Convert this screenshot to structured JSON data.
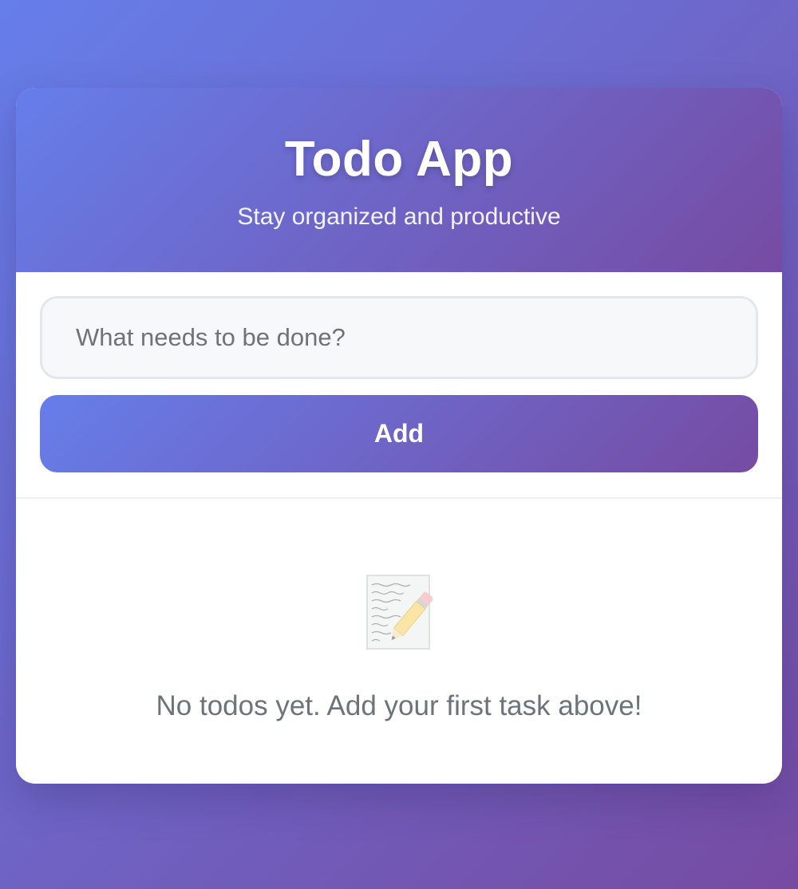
{
  "header": {
    "title": "Todo App",
    "subtitle": "Stay organized and productive"
  },
  "form": {
    "input_placeholder": "What needs to be done?",
    "input_value": "",
    "add_label": "Add"
  },
  "empty_state": {
    "icon": "memo-icon",
    "message": "No todos yet. Add your first task above!"
  },
  "colors": {
    "gradient_start": "#667eea",
    "gradient_end": "#764ba2",
    "card_background": "#ffffff",
    "muted_text": "#6c7379"
  }
}
